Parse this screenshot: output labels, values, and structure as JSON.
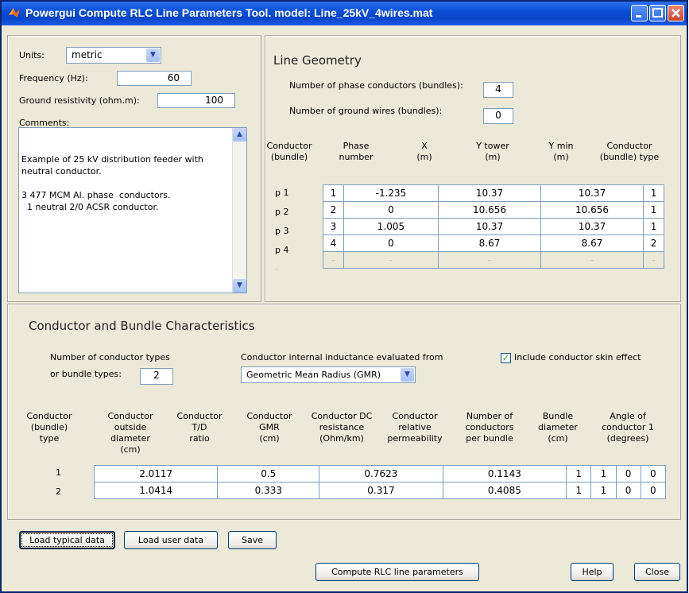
{
  "window": {
    "title": "Powergui Compute RLC Line Parameters Tool.  model: Line_25kV_4wires.mat"
  },
  "settings": {
    "units_label": "Units:",
    "units_value": "metric",
    "frequency_label": "Frequency (Hz):",
    "frequency_value": "60",
    "ground_label": "Ground resistivity (ohm.m):",
    "ground_value": "100",
    "comments_label": "Comments:",
    "comments_text": "Example of 25 kV distribution feeder with\nneutral conductor.\n\n3 477 MCM Al. phase  conductors.\n  1 neutral 2/0 ACSR conductor."
  },
  "geometry": {
    "title": "Line Geometry",
    "phase_label": "Number of phase conductors (bundles):",
    "phase_value": "4",
    "ground_label": "Number of ground wires (bundles):",
    "ground_value": "0",
    "headers": [
      [
        "Conductor",
        "(bundle)"
      ],
      [
        "Phase",
        "number"
      ],
      [
        "X",
        "(m)"
      ],
      [
        "Y tower",
        "(m)"
      ],
      [
        "Y min",
        "(m)"
      ],
      [
        "Conductor",
        "(bundle) type"
      ]
    ],
    "rows": [
      {
        "label": "p 1",
        "cells": [
          "1",
          "-1.235",
          "10.37",
          "10.37",
          "1"
        ]
      },
      {
        "label": "p 2",
        "cells": [
          "2",
          "0",
          "10.656",
          "10.656",
          "1"
        ]
      },
      {
        "label": "p 3",
        "cells": [
          "3",
          "1.005",
          "10.37",
          "10.37",
          "1"
        ]
      },
      {
        "label": "p 4",
        "cells": [
          "4",
          "0",
          "8.67",
          "8.67",
          "2"
        ]
      },
      {
        "label": "-",
        "cells": [
          "-",
          "-",
          "-",
          "-",
          "-"
        ]
      }
    ]
  },
  "conductors": {
    "title": "Conductor and Bundle Characteristics",
    "types_label_1": "Number of conductor types",
    "types_label_2": "or bundle types:",
    "types_value": "2",
    "inductance_label": "Conductor internal inductance evaluated from",
    "inductance_value": "Geometric Mean Radius (GMR)",
    "skin_label": "Include conductor skin effect",
    "skin_checked": true,
    "headers": [
      [
        "Conductor",
        "(bundle)",
        "type"
      ],
      [
        "Conductor",
        "outside diameter",
        "(cm)"
      ],
      [
        "Conductor",
        "T/D",
        "ratio"
      ],
      [
        "Conductor",
        "GMR",
        "(cm)"
      ],
      [
        "Conductor DC",
        "resistance",
        "(Ohm/km)"
      ],
      [
        "Conductor",
        "relative",
        "permeability"
      ],
      [
        "Number of",
        "conductors",
        "per bundle"
      ],
      [
        "Bundle",
        "diameter",
        "(cm)"
      ],
      [
        "Angle of",
        "conductor 1",
        "(degrees)"
      ]
    ],
    "rows": [
      {
        "label": "1",
        "cells": [
          "2.0117",
          "0.5",
          "0.7623",
          "0.1143",
          "1",
          "1",
          "0",
          "0"
        ]
      },
      {
        "label": "2",
        "cells": [
          "1.0414",
          "0.333",
          "0.317",
          "0.4085",
          "1",
          "1",
          "0",
          "0"
        ]
      }
    ]
  },
  "buttons": {
    "load_typical": "Load typical data",
    "load_user": "Load user data",
    "save": "Save",
    "compute": "Compute RLC line parameters",
    "help": "Help",
    "close": "Close"
  }
}
